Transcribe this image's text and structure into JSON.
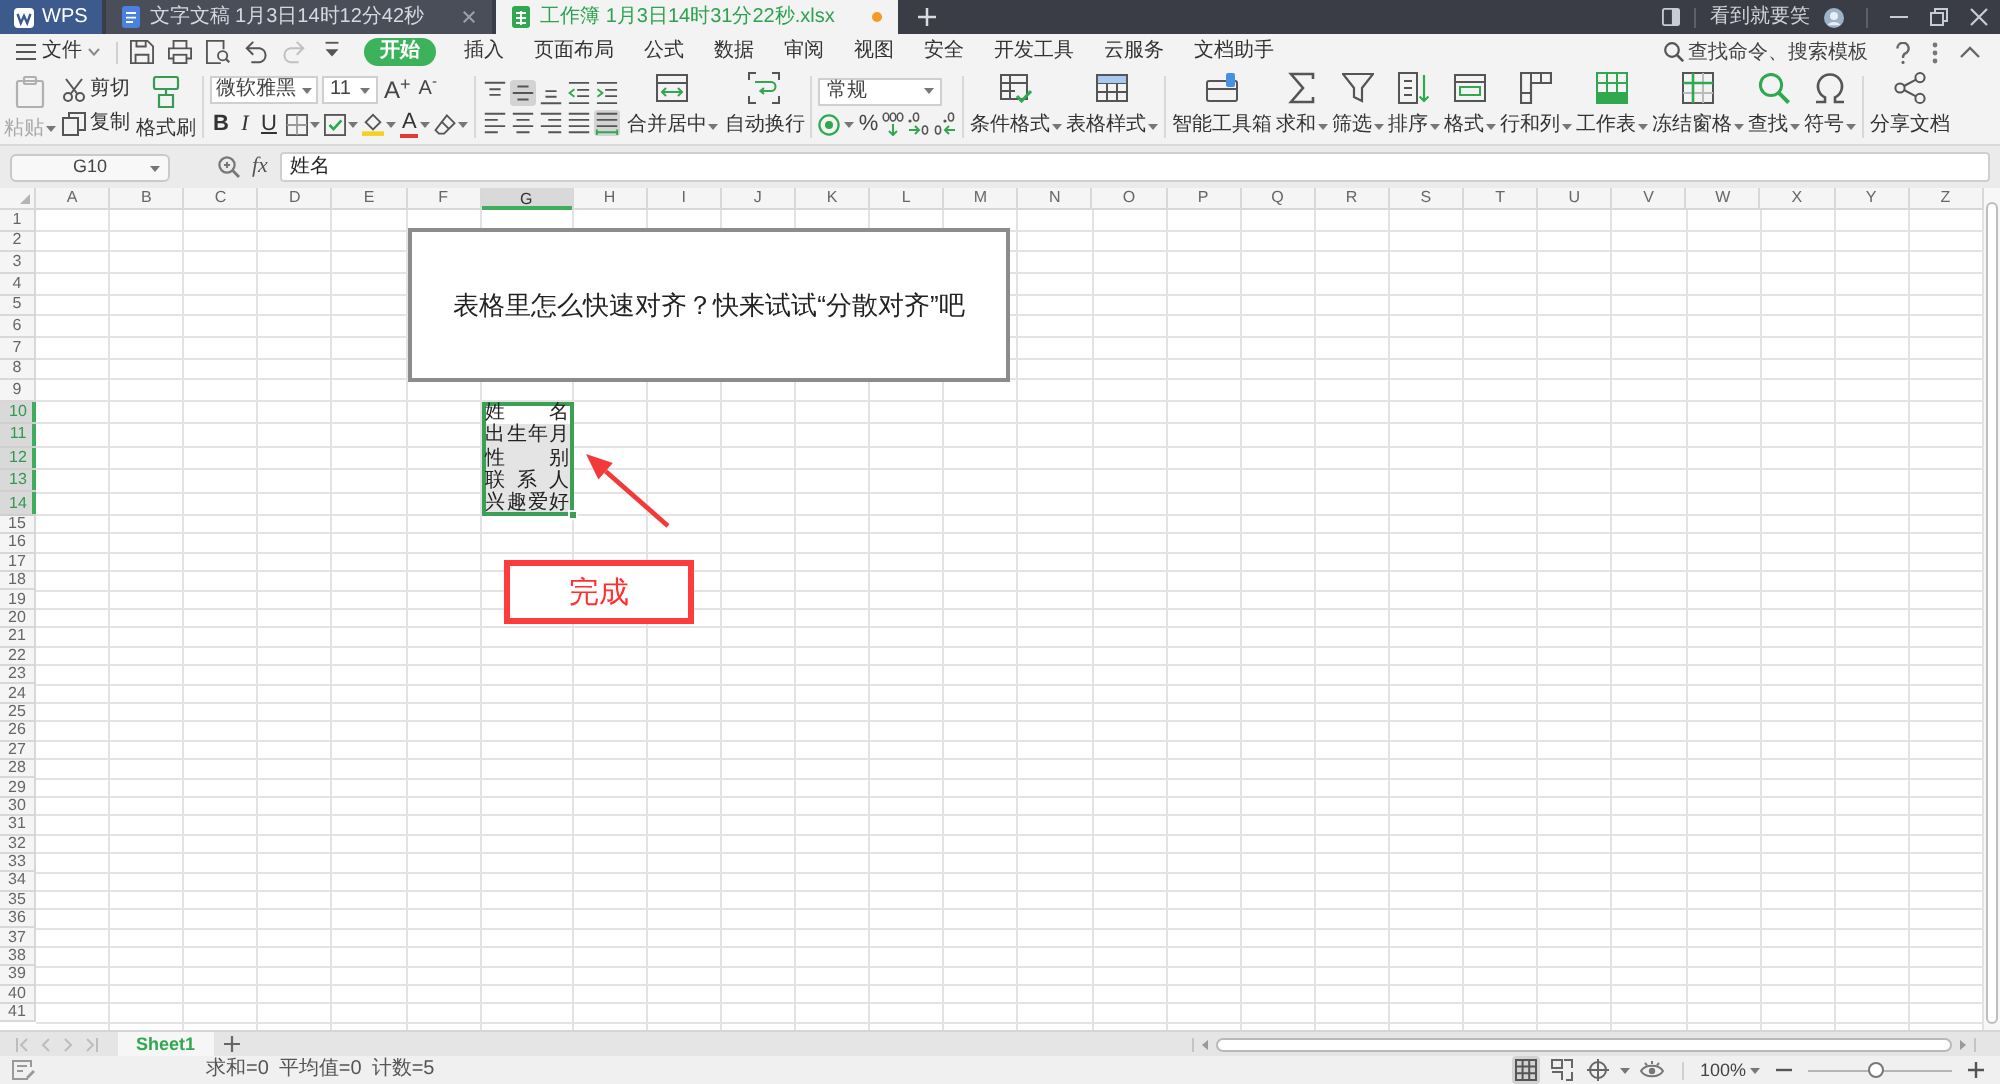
{
  "title_bar": {
    "app": "WPS",
    "tabs": [
      {
        "kind": "document",
        "label": "文字文稿 1月3日14时12分42秒",
        "selected": false,
        "modified": false
      },
      {
        "kind": "spreadsheet",
        "label": "工作簿 1月3日14时31分22秒.xlsx",
        "selected": true,
        "modified": true
      }
    ],
    "user": "看到就要笑"
  },
  "menu_bar": {
    "file": "文件",
    "quick_access": [
      {
        "kind": "save",
        "disabled": false
      },
      {
        "kind": "print",
        "disabled": false
      },
      {
        "kind": "preview",
        "disabled": false
      },
      {
        "kind": "undo",
        "disabled": false
      },
      {
        "kind": "redo",
        "disabled": true
      },
      {
        "kind": "customize",
        "disabled": false
      }
    ],
    "tabs": [
      {
        "label": "开始",
        "selected": true
      },
      {
        "label": "插入",
        "selected": false
      },
      {
        "label": "页面布局",
        "selected": false
      },
      {
        "label": "公式",
        "selected": false
      },
      {
        "label": "数据",
        "selected": false
      },
      {
        "label": "审阅",
        "selected": false
      },
      {
        "label": "视图",
        "selected": false
      },
      {
        "label": "安全",
        "selected": false
      },
      {
        "label": "开发工具",
        "selected": false
      },
      {
        "label": "云服务",
        "selected": false
      },
      {
        "label": "文档助手",
        "selected": false
      }
    ],
    "search": {
      "placeholder": "查找命令、搜索模板"
    }
  },
  "ribbon": {
    "clipboard": [
      {
        "kind": "paste",
        "label": "粘贴",
        "disabled": true
      },
      {
        "kind": "cut",
        "label": "剪切",
        "disabled": false
      },
      {
        "kind": "copy",
        "label": "复制",
        "disabled": false
      },
      {
        "kind": "painter",
        "label": "格式刷",
        "disabled": false
      }
    ],
    "font_name": "微软雅黑",
    "font_size": "11",
    "size_buttons": [
      {
        "kind": "grow",
        "text": "A$^{+}$"
      },
      {
        "kind": "shrink",
        "text": "A$^{-}$"
      }
    ],
    "style_buttons": [
      {
        "kind": "bold",
        "text": "B"
      },
      {
        "kind": "italic",
        "text": "I"
      },
      {
        "kind": "underline",
        "text": "U"
      }
    ],
    "font_color_text": "A",
    "vertical_align": [
      {
        "kind": "top",
        "selected": false
      },
      {
        "kind": "middle",
        "selected": true
      },
      {
        "kind": "bottom",
        "selected": false
      }
    ],
    "horizontal_align": [
      {
        "kind": "left",
        "selected": false
      },
      {
        "kind": "center",
        "selected": false
      },
      {
        "kind": "right",
        "selected": false
      },
      {
        "kind": "justify",
        "selected": false
      },
      {
        "kind": "distributed",
        "selected": true
      }
    ],
    "align_tools": [
      {
        "kind": "merge",
        "label": "合并居中",
        "dropdown": true
      },
      {
        "kind": "wrap",
        "label": "自动换行",
        "dropdown": false
      }
    ],
    "number_format": "常规",
    "number_buttons": [
      {
        "kind": "currency"
      },
      {
        "kind": "percent",
        "text": "%"
      },
      {
        "kind": "thousands"
      },
      {
        "kind": "more_decimals"
      },
      {
        "kind": "fewer_decimals"
      }
    ],
    "tool_groups": [
      [
        {
          "kind": "conditional",
          "label": "条件格式",
          "dropdown": true
        },
        {
          "kind": "table_style",
          "label": "表格样式",
          "dropdown": true
        }
      ],
      [
        {
          "kind": "toolbox",
          "label": "智能工具箱",
          "dropdown": false
        },
        {
          "kind": "sum",
          "label": "求和",
          "dropdown": true
        },
        {
          "kind": "filter",
          "label": "筛选",
          "dropdown": true
        },
        {
          "kind": "sort",
          "label": "排序",
          "dropdown": true
        },
        {
          "kind": "format",
          "label": "格式",
          "dropdown": true
        },
        {
          "kind": "rows_columns",
          "label": "行和列",
          "dropdown": true
        },
        {
          "kind": "worksheet",
          "label": "工作表",
          "dropdown": true
        },
        {
          "kind": "freeze",
          "label": "冻结窗格",
          "dropdown": true
        },
        {
          "kind": "find",
          "label": "查找",
          "dropdown": true
        },
        {
          "kind": "symbol",
          "label": "符号",
          "dropdown": true
        }
      ],
      [
        {
          "kind": "share",
          "label": "分享文档",
          "dropdown": false
        }
      ]
    ]
  },
  "formula_bar": {
    "name_box": "G10",
    "function_label": "fx",
    "formula": "姓名"
  },
  "grid": {
    "columns": [
      {
        "label": "A",
        "selected": false
      },
      {
        "label": "B",
        "selected": false
      },
      {
        "label": "C",
        "selected": false
      },
      {
        "label": "D",
        "selected": false
      },
      {
        "label": "E",
        "selected": false
      },
      {
        "label": "F",
        "selected": false
      },
      {
        "label": "G",
        "selected": true
      },
      {
        "label": "H",
        "selected": false
      },
      {
        "label": "I",
        "selected": false
      },
      {
        "label": "J",
        "selected": false
      },
      {
        "label": "K",
        "selected": false
      },
      {
        "label": "L",
        "selected": false
      },
      {
        "label": "M",
        "selected": false
      },
      {
        "label": "N",
        "selected": false
      },
      {
        "label": "O",
        "selected": false
      },
      {
        "label": "P",
        "selected": false
      },
      {
        "label": "Q",
        "selected": false
      },
      {
        "label": "R",
        "selected": false
      },
      {
        "label": "S",
        "selected": false
      },
      {
        "label": "T",
        "selected": false
      },
      {
        "label": "U",
        "selected": false
      },
      {
        "label": "V",
        "selected": false
      },
      {
        "label": "W",
        "selected": false
      },
      {
        "label": "X",
        "selected": false
      },
      {
        "label": "Y",
        "selected": false
      },
      {
        "label": "Z",
        "selected": false
      }
    ],
    "rows": [
      {
        "label": "1",
        "selected": false
      },
      {
        "label": "2",
        "selected": false
      },
      {
        "label": "3",
        "selected": false
      },
      {
        "label": "4",
        "selected": false
      },
      {
        "label": "5",
        "selected": false
      },
      {
        "label": "6",
        "selected": false
      },
      {
        "label": "7",
        "selected": false
      },
      {
        "label": "8",
        "selected": false
      },
      {
        "label": "9",
        "selected": false
      },
      {
        "label": "10",
        "selected": true,
        "cells": {
          "G": {
            "value": "姓名",
            "selected": true,
            "active": true
          }
        }
      },
      {
        "label": "11",
        "selected": true,
        "cells": {
          "G": {
            "value": "出生年月",
            "selected": true,
            "active": false
          }
        }
      },
      {
        "label": "12",
        "selected": true,
        "cells": {
          "G": {
            "value": "性别",
            "selected": true,
            "active": false
          }
        }
      },
      {
        "label": "13",
        "selected": true,
        "cells": {
          "G": {
            "value": "联系人",
            "selected": true,
            "active": false
          }
        }
      },
      {
        "label": "14",
        "selected": true,
        "cells": {
          "G": {
            "value": "兴趣爱好",
            "selected": true,
            "active": false
          }
        }
      },
      {
        "label": "15",
        "selected": false
      },
      {
        "label": "16",
        "selected": false
      },
      {
        "label": "17",
        "selected": false
      },
      {
        "label": "18",
        "selected": false
      },
      {
        "label": "19",
        "selected": false
      },
      {
        "label": "20",
        "selected": false
      },
      {
        "label": "21",
        "selected": false
      },
      {
        "label": "22",
        "selected": false
      },
      {
        "label": "23",
        "selected": false
      },
      {
        "label": "24",
        "selected": false
      },
      {
        "label": "25",
        "selected": false
      },
      {
        "label": "26",
        "selected": false
      },
      {
        "label": "27",
        "selected": false
      },
      {
        "label": "28",
        "selected": false
      },
      {
        "label": "29",
        "selected": false
      },
      {
        "label": "30",
        "selected": false
      },
      {
        "label": "31",
        "selected": false
      },
      {
        "label": "32",
        "selected": false
      },
      {
        "label": "33",
        "selected": false
      },
      {
        "label": "34",
        "selected": false
      },
      {
        "label": "35",
        "selected": false
      },
      {
        "label": "36",
        "selected": false
      },
      {
        "label": "37",
        "selected": false
      },
      {
        "label": "38",
        "selected": false
      },
      {
        "label": "39",
        "selected": false
      },
      {
        "label": "40",
        "selected": false
      },
      {
        "label": "41",
        "selected": false
      }
    ]
  },
  "text_box": {
    "text": "表格里怎么快速对齐？快来试试“分散对齐”吧"
  },
  "callout": {
    "text": "完成"
  },
  "sheet_tabs": [
    {
      "label": "Sheet1",
      "selected": true
    }
  ],
  "status_bar": {
    "stats": [
      "求和=0",
      "平均值=0",
      "计数=5"
    ],
    "view_buttons": [
      {
        "kind": "normal",
        "selected": true
      },
      {
        "kind": "page_break",
        "selected": false
      },
      {
        "kind": "reading",
        "selected": false
      },
      {
        "kind": "eye",
        "selected": false
      }
    ],
    "zoom": {
      "text": "100%",
      "level": 0.47
    }
  }
}
